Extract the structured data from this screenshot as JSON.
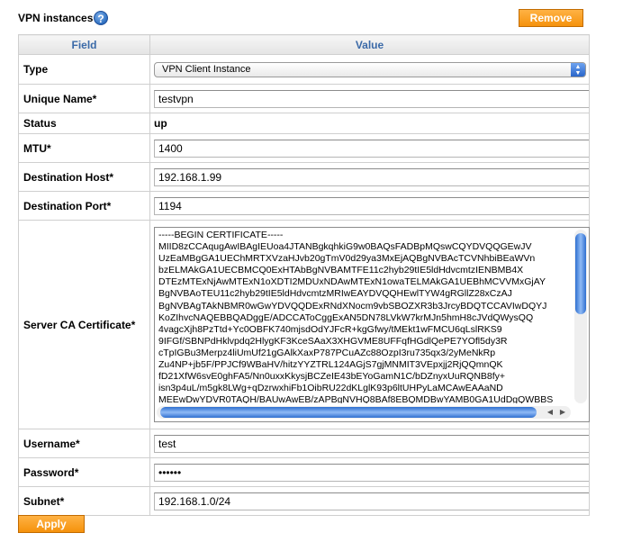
{
  "header": {
    "title": "VPN instances",
    "help_icon": "?"
  },
  "buttons": {
    "remove": "Remove",
    "apply": "Apply"
  },
  "table": {
    "col_field": "Field",
    "col_value": "Value"
  },
  "fields": {
    "type": {
      "label": "Type",
      "value": "VPN Client Instance"
    },
    "unique_name": {
      "label": "Unique Name*",
      "value": "testvpn"
    },
    "status": {
      "label": "Status",
      "value": "up"
    },
    "mtu": {
      "label": "MTU*",
      "value": "1400"
    },
    "dest_host": {
      "label": "Destination Host*",
      "value": "192.168.1.99"
    },
    "dest_port": {
      "label": "Destination Port*",
      "value": "1194"
    },
    "server_ca": {
      "label": "Server CA Certificate*",
      "value": "-----BEGIN CERTIFICATE-----\nMIID8zCCAqugAwIBAgIEUoa4JTANBgkqhkiG9w0BAQsFADBpMQswCQYDVQQGEwJV\nUzEaMBgGA1UEChMRTXVzaHJvb20gTmV0d29ya3MxEjAQBgNVBAcTCVNhbiBEaWVn\nbzELMAkGA1UECBMCQ0ExHTAbBgNVBAMTFE11c2hyb29tIE5ldHdvcmtzIENBMB4X\nDTEzMTExNjAwMTExN1oXDTI2MDUxNDAwMTExN1owaTELMAkGA1UEBhMCVVMxGjAY\nBgNVBAoTEU11c2hyb29tIE5ldHdvcmtzMRIwEAYDVQQHEwlTYW4gRGllZ28xCzAJ\nBgNVBAgTAkNBMR0wGwYDVQQDExRNdXNocm9vbSBOZXR3b3JrcyBDQTCCAVIwDQYJ\nKoZIhvcNAQEBBQADggE/ADCCAToCggExAN5DN78LVkW7krMJn5hmH8cJVdQWysQQ\n4vagcXjh8PzTtd+Yc0OBFK740mjsdOdYJFcR+kgGfwy/tMEkt1wFMCU6qLslRKS9\n9IFGf/SBNPdHklvpdq2HlygKF3KceSAaX3XHGVME8UFFqfHGdlQePE7YOfl5dy3R\ncTpIGBu3Merpz4liUmUf21gGAlkXaxP787PCuAZc88OzpI3ru735qx3/2yMeNkRp\nZu4NP+jb5F/PPJCf9WBaHV/hitzYYZTRL124AGjS7gjMNMIT3VEpxjj2RjQQmnQK\nfD21XfW6svE0ghFA5/Nn0uxxKkysjBCZeIE43bEYoGamN1C/bDZnyxUuRQNB8fy+\nisn3p4uL/m5gk8LWg+qDzrwxhiFb1OibRU22dKLglK93p6ltUHPyLaMCAwEAAaND\nMEEwDwYDVR0TAQH/BAUwAwEB/zAPBgNVHQ8BAf8EBQMDBwYAMB0GA1UdDgQWBBS"
    },
    "username": {
      "label": "Username*",
      "value": "test"
    },
    "password": {
      "label": "Password*",
      "value": "••••••"
    },
    "subnet": {
      "label": "Subnet*",
      "value": "192.168.1.0/24"
    }
  }
}
